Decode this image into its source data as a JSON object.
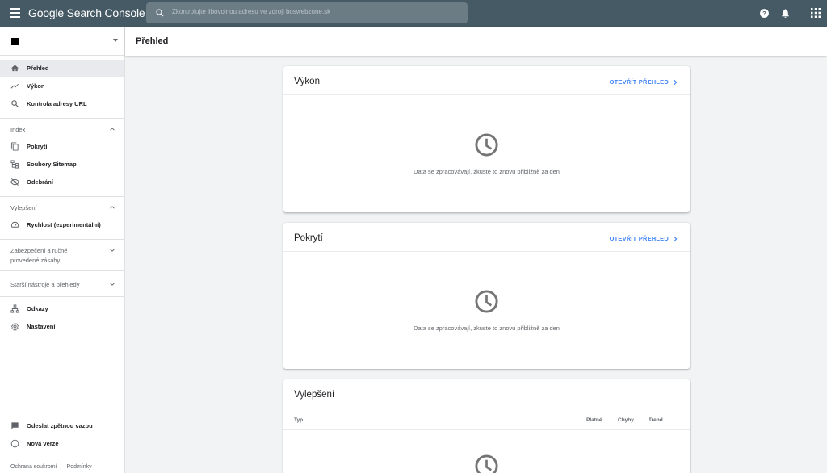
{
  "app": {
    "title": "Google Search Console"
  },
  "search": {
    "placeholder": "Zkontrolujte libovolnou adresu ve zdroji boswebzone.sk"
  },
  "sidebar": {
    "items_top": [
      {
        "label": "Přehled",
        "icon": "home-icon",
        "active": true
      },
      {
        "label": "Výkon",
        "icon": "trending-icon"
      },
      {
        "label": "Kontrola adresy URL",
        "icon": "search-icon"
      }
    ],
    "section_index": {
      "label": "Index"
    },
    "items_index": [
      {
        "label": "Pokrytí",
        "icon": "file-copy-icon"
      },
      {
        "label": "Soubory Sitemap",
        "icon": "sitemap-icon"
      },
      {
        "label": "Odebrání",
        "icon": "eye-off-icon"
      }
    ],
    "section_improve": {
      "label": "Vylepšení"
    },
    "items_improve": [
      {
        "label": "Rychlost (experimentální)",
        "icon": "speed-icon"
      }
    ],
    "section_security": {
      "line1": "Zabezpečení a ručně",
      "line2": "provedené zásahy"
    },
    "section_legacy": {
      "label": "Starší nástroje a přehledy"
    },
    "items_bottom": [
      {
        "label": "Odkazy",
        "icon": "links-icon"
      },
      {
        "label": "Nastavení",
        "icon": "gear-icon"
      }
    ],
    "items_footer": [
      {
        "label": "Odeslat zpětnou vazbu",
        "icon": "feedback-icon"
      },
      {
        "label": "Nová verze",
        "icon": "info-icon"
      }
    ],
    "links": {
      "privacy": "Ochrana soukromí",
      "terms": "Podmínky"
    }
  },
  "page": {
    "title": "Přehled"
  },
  "cards": {
    "performance": {
      "title": "Výkon",
      "link": "OTEVŘÍT PŘEHLED",
      "message": "Data se zpracovávají, zkuste to znovu přibližně za den"
    },
    "coverage": {
      "title": "Pokrytí",
      "link": "OTEVŘÍT PŘEHLED",
      "message": "Data se zpracovávají, zkuste to znovu přibližně za den"
    },
    "enhancements": {
      "title": "Vylepšení",
      "columns": {
        "type": "Typ",
        "valid": "Platné",
        "errors": "Chyby",
        "trend": "Trend"
      }
    }
  },
  "colors": {
    "topbar": "#455a64",
    "accent": "#4285f4",
    "active_nav": "#e8eaed"
  }
}
